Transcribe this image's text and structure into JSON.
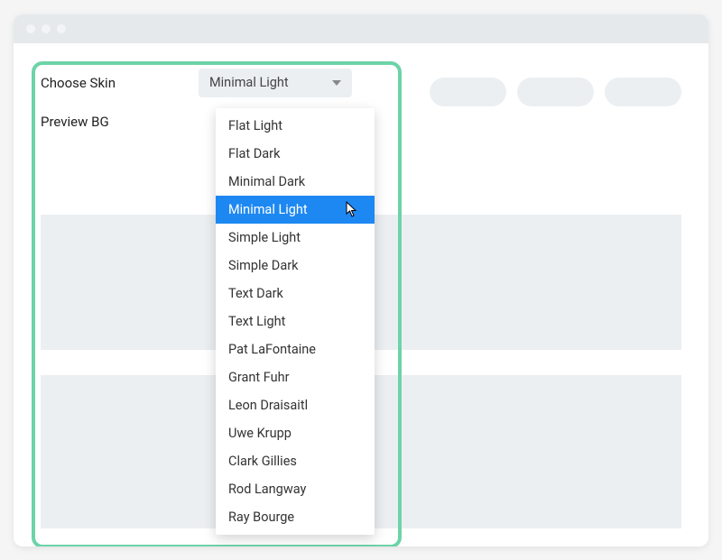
{
  "labels": {
    "choose_skin": "Choose Skin",
    "preview_bg": "Preview BG"
  },
  "select": {
    "value": "Minimal Light"
  },
  "dropdown": {
    "items": [
      {
        "label": "Flat Light",
        "selected": false
      },
      {
        "label": "Flat Dark",
        "selected": false
      },
      {
        "label": "Minimal Dark",
        "selected": false
      },
      {
        "label": "Minimal Light",
        "selected": true
      },
      {
        "label": "Simple Light",
        "selected": false
      },
      {
        "label": "Simple Dark",
        "selected": false
      },
      {
        "label": "Text Dark",
        "selected": false
      },
      {
        "label": "Text Light",
        "selected": false
      },
      {
        "label": "Pat LaFontaine",
        "selected": false
      },
      {
        "label": "Grant Fuhr",
        "selected": false
      },
      {
        "label": "Leon Draisaitl",
        "selected": false
      },
      {
        "label": "Uwe Krupp",
        "selected": false
      },
      {
        "label": "Clark Gillies",
        "selected": false
      },
      {
        "label": "Rod Langway",
        "selected": false
      },
      {
        "label": "Ray Bourge",
        "selected": false
      }
    ]
  }
}
